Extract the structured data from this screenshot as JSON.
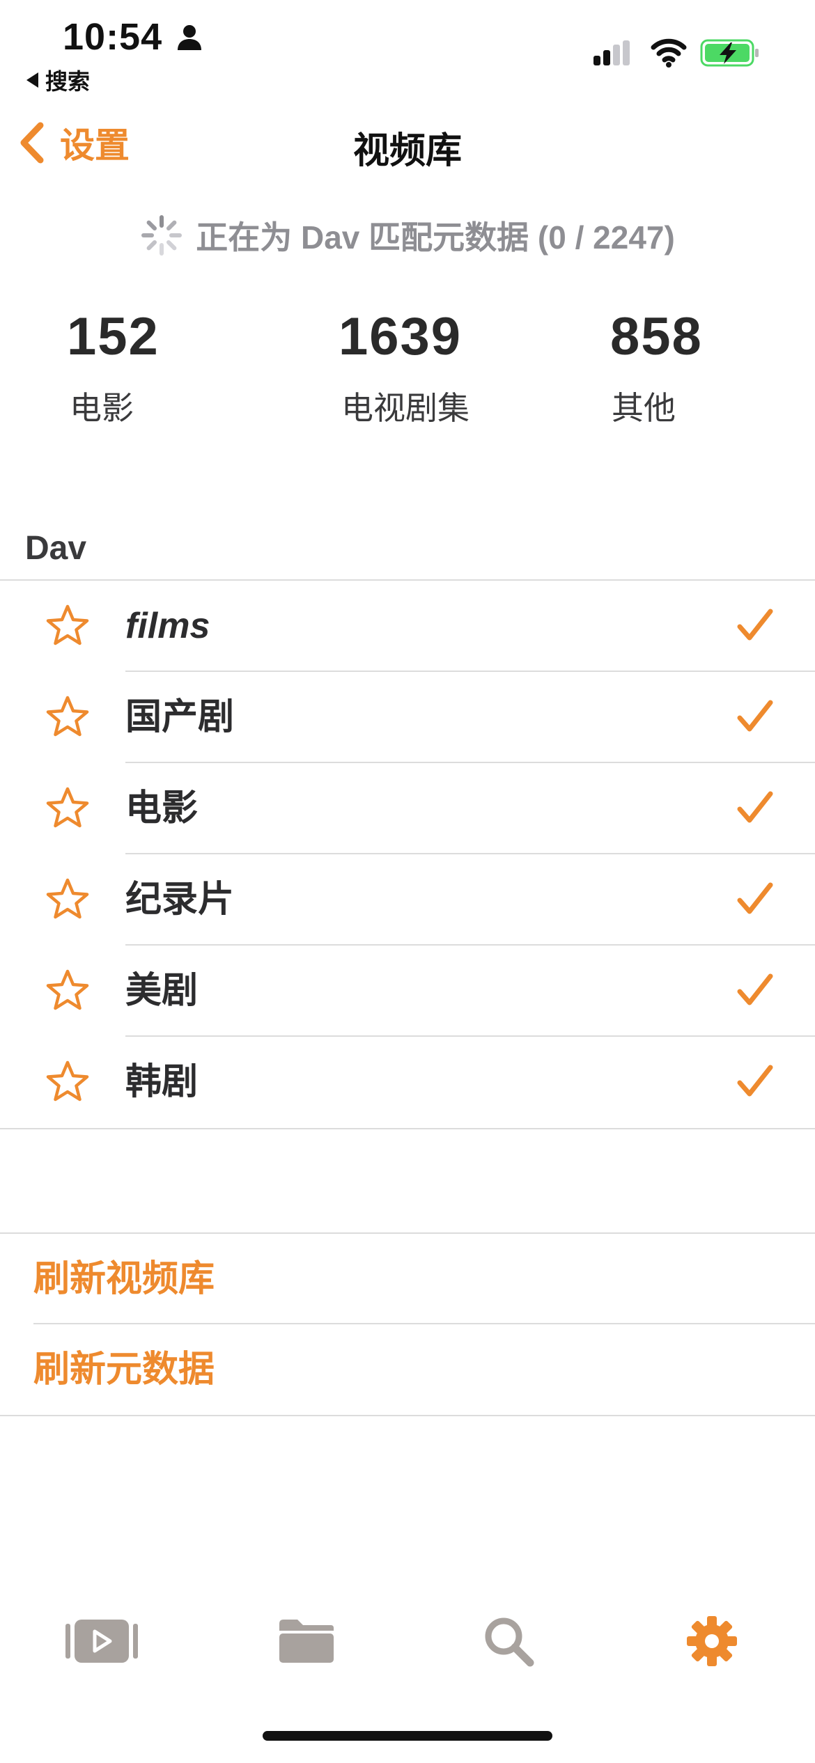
{
  "status_bar": {
    "time": "10:54",
    "back_app": "搜索",
    "icons": [
      "person-icon",
      "signal-icon",
      "wifi-icon",
      "battery-charging-icon"
    ]
  },
  "nav": {
    "back_label": "设置",
    "title": "视频库"
  },
  "sync": {
    "text": "正在为 Dav 匹配元数据 (0 / 2247)"
  },
  "stats": [
    {
      "value": "152",
      "label": "电影"
    },
    {
      "value": "1639",
      "label": "电视剧集"
    },
    {
      "value": "858",
      "label": "其他"
    }
  ],
  "section": {
    "header": "Dav",
    "items": [
      {
        "label": "films",
        "checked": true
      },
      {
        "label": "国产剧",
        "checked": true
      },
      {
        "label": "电影",
        "checked": true
      },
      {
        "label": "纪录片",
        "checked": true
      },
      {
        "label": "美剧",
        "checked": true
      },
      {
        "label": "韩剧",
        "checked": true
      }
    ]
  },
  "actions": [
    "刷新视频库",
    "刷新元数据"
  ],
  "tab_bar": {
    "tabs": [
      "video-library-icon",
      "folder-icon",
      "search-icon",
      "settings-gear-icon"
    ],
    "active": "settings-gear-icon"
  },
  "colors": {
    "accent": "#EE8A2E",
    "inactive_icon": "#a8a29e",
    "battery_green": "#4cd964"
  }
}
